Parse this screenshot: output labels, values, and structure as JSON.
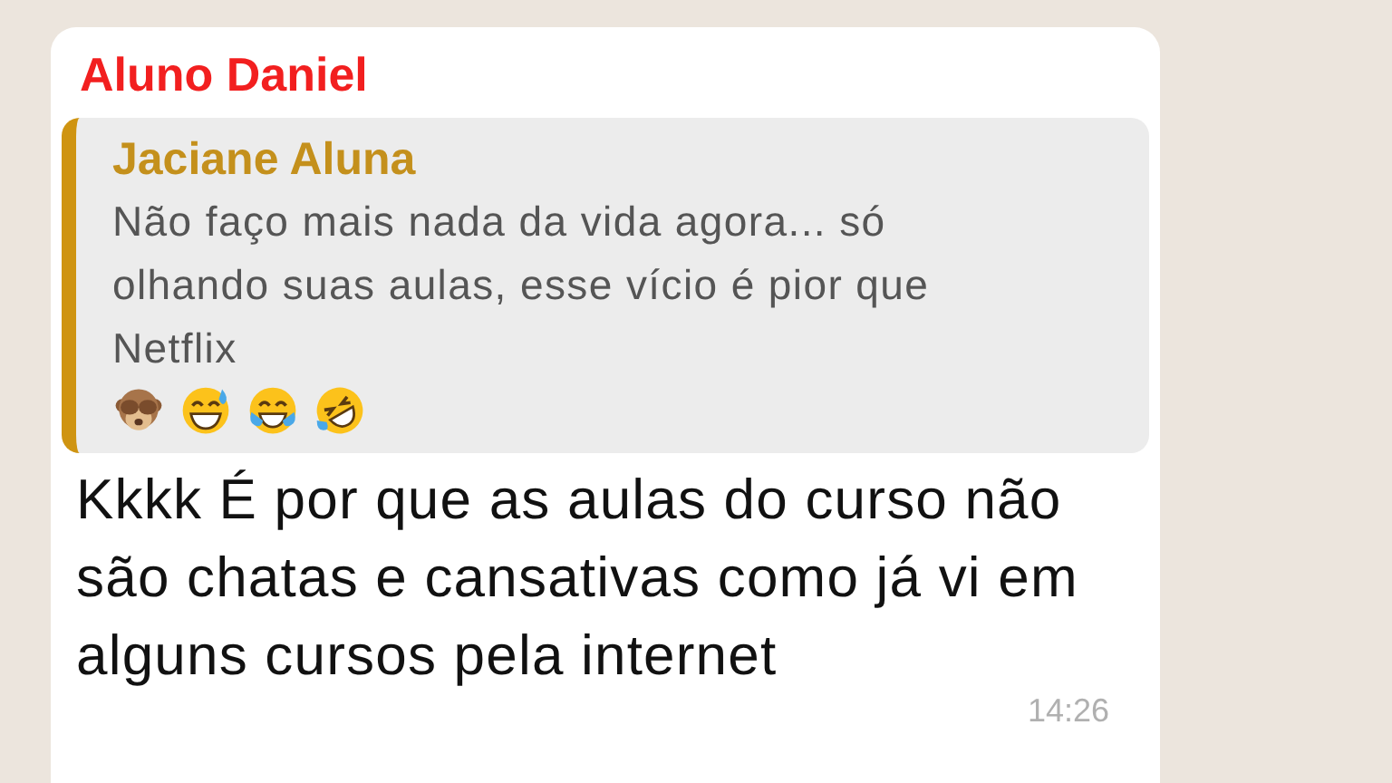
{
  "message": {
    "sender": "Aluno Daniel",
    "quoted": {
      "sender": "Jaciane Aluna",
      "text": "Não faço mais nada da vida agora... só olhando suas aulas, esse vício é pior que Netflix",
      "emoji": [
        {
          "kind": "monkey"
        },
        {
          "kind": "sweat-smile"
        },
        {
          "kind": "tears-of-joy"
        },
        {
          "kind": "rolling"
        }
      ]
    },
    "text": "Kkkk É por que as aulas do curso não são chatas e cansativas como já vi em alguns cursos pela internet",
    "time": "14:26"
  }
}
